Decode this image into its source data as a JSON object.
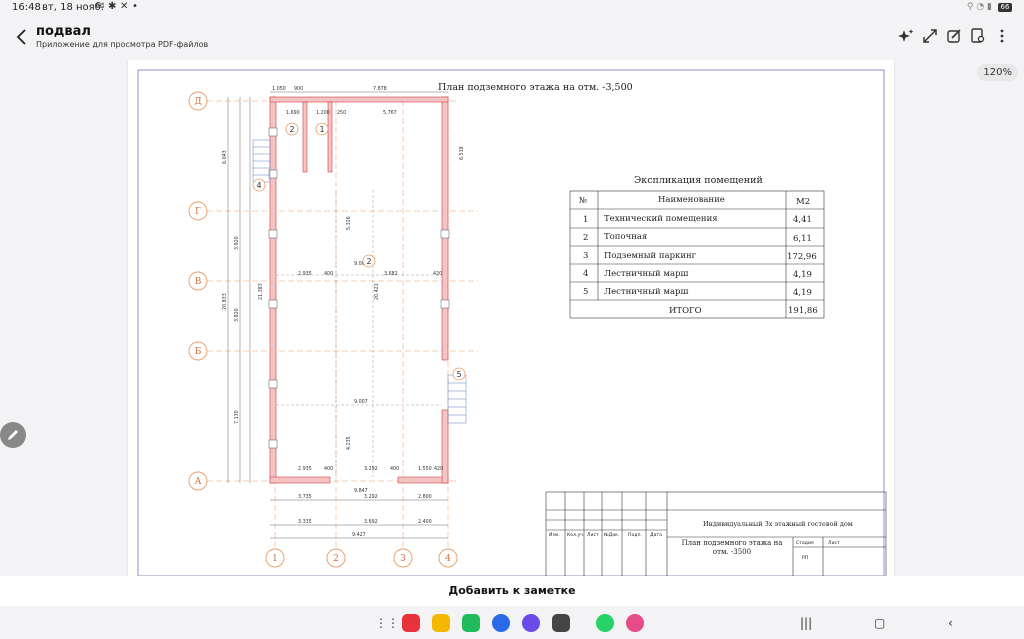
{
  "status_bar": {
    "time": "16:48",
    "date": "вт, 18 нояб.",
    "battery": "66"
  },
  "header": {
    "title": "подвал",
    "subtitle": "Приложение для просмотра PDF-файлов"
  },
  "zoom": "120%",
  "bottom": {
    "add_note": "Добавить к заметке"
  },
  "plan": {
    "title": "План подземного  этажа на отм.  -3,500",
    "axes_rows": [
      "Д",
      "Г",
      "В",
      "Б",
      "А"
    ],
    "axes_cols": [
      "1",
      "2",
      "3",
      "4"
    ],
    "dims_top": [
      "1.050",
      "900",
      "7.878"
    ],
    "dims_inner": [
      "1.690",
      "1.200",
      "250",
      "5.767"
    ],
    "dims_bottom1": [
      "3.735",
      "3.292",
      "2.800"
    ],
    "dims_bottom2": [
      "3.335",
      "3.692",
      "2.400"
    ],
    "dims_total": "9.427",
    "dims_row_mid": [
      "2.935",
      "400",
      "3.682",
      "420"
    ],
    "dims_row_bot": [
      "2.935",
      "400",
      "3.292",
      "400",
      "1.550",
      "420"
    ],
    "dims_left": [
      "6.043",
      "3.920",
      "3.820",
      "7.130",
      "20.833"
    ],
    "room_numbers": [
      "2",
      "1",
      "4",
      "2",
      "5"
    ],
    "misc_dims": [
      "9.007",
      "9.007",
      "9.847",
      "20.421",
      "21.383",
      "4.235",
      "5.326",
      "6.518"
    ]
  },
  "explication": {
    "title": "Экспликация помещений",
    "headers": [
      "№",
      "Наименование",
      "М2"
    ],
    "rows": [
      {
        "n": "1",
        "name": "Технический помещения",
        "area": "4,41"
      },
      {
        "n": "2",
        "name": "Топочная",
        "area": "6,11"
      },
      {
        "n": "3",
        "name": "Подземный паркинг",
        "area": "172,96"
      },
      {
        "n": "4",
        "name": "Лестничный марш",
        "area": "4,19"
      },
      {
        "n": "5",
        "name": "Лестничный марш",
        "area": "4,19"
      }
    ],
    "total_label": "ИТОГО",
    "total_value": "191,86"
  },
  "stamp": {
    "project": "Индивидуальный 3х этажный гостевой дом",
    "cols": [
      "Изм.",
      "Кол.уч.",
      "Лист",
      "№Док.",
      "Подп.",
      "Дата"
    ],
    "sheet_title": "План подземного этажа на отм. -3500",
    "stage_label": "Стадия",
    "sheet_label": "Лист",
    "stage_value": "РП"
  }
}
